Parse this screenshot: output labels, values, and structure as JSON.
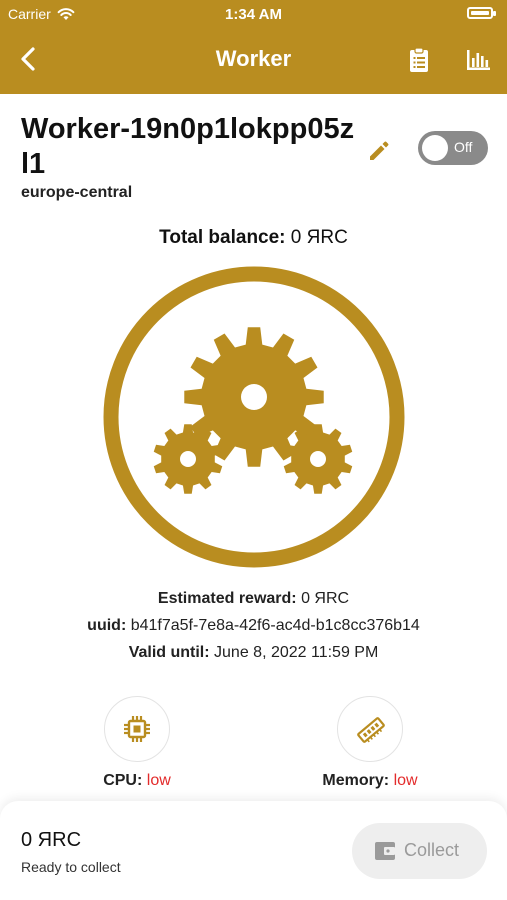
{
  "status_bar": {
    "carrier": "Carrier",
    "time": "1:34 AM",
    "battery_level": 1.0
  },
  "nav": {
    "title": "Worker",
    "back_icon": "chevron-left-icon",
    "actions": [
      "clipboard-icon",
      "bar-chart-icon"
    ]
  },
  "worker": {
    "name": "Worker-19n0p1lokpp05zl1",
    "region": "europe-central",
    "edit_icon": "pencil-icon",
    "toggle_label": "Off",
    "toggle_on": false
  },
  "balance": {
    "label": "Total balance:",
    "value": "0 ЯRC"
  },
  "info": {
    "reward_label": "Estimated reward:",
    "reward_value": "0 ЯRC",
    "uuid_label": "uuid:",
    "uuid_value": "b41f7a5f-7e8a-42f6-ac4d-b1c8cc376b14",
    "valid_label": "Valid until:",
    "valid_value": "June 8, 2022 11:59 PM"
  },
  "resources": [
    {
      "icon": "cpu-chip-icon",
      "label": "CPU:",
      "value": "low"
    },
    {
      "icon": "memory-stick-icon",
      "label": "Memory:",
      "value": "low"
    }
  ],
  "bottom": {
    "amount": "0 ЯRC",
    "subtitle": "Ready to collect",
    "collect_label": "Collect",
    "collect_icon": "wallet-icon"
  },
  "colors": {
    "brand": "#B98D20",
    "status_low": "#E32B2B",
    "toggle_off": "#8A8A8A",
    "disabled_button": "#EEEEEE"
  }
}
